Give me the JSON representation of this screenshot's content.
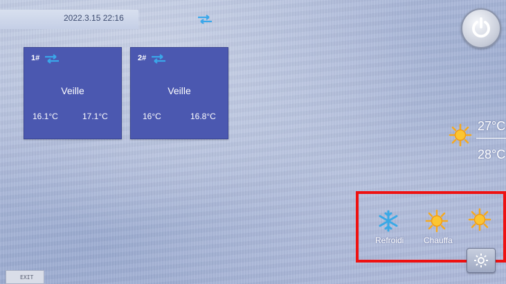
{
  "header": {
    "datetime": "2022.3.15 22:16"
  },
  "units": [
    {
      "id": "1#",
      "status": "Veille",
      "temp_a": "16.1°C",
      "temp_b": "17.1°C"
    },
    {
      "id": "2#",
      "status": "Veille",
      "temp_a": "16°C",
      "temp_b": "16.8°C"
    }
  ],
  "outdoor": {
    "temp_top": "27°C",
    "temp_bottom": "28°C"
  },
  "modes": {
    "cool_label": "Refroidi",
    "heat_label": "Chauffa"
  },
  "footer": {
    "exit_label": "EXIT"
  },
  "colors": {
    "card": "#4b58b0",
    "highlight": "#ee1111",
    "sun": "#f6a91e",
    "snow": "#39a9e6"
  },
  "icons": [
    "network-arrows-icon",
    "power-icon",
    "sun-icon",
    "snowflake-icon",
    "settings-gear-icon"
  ]
}
